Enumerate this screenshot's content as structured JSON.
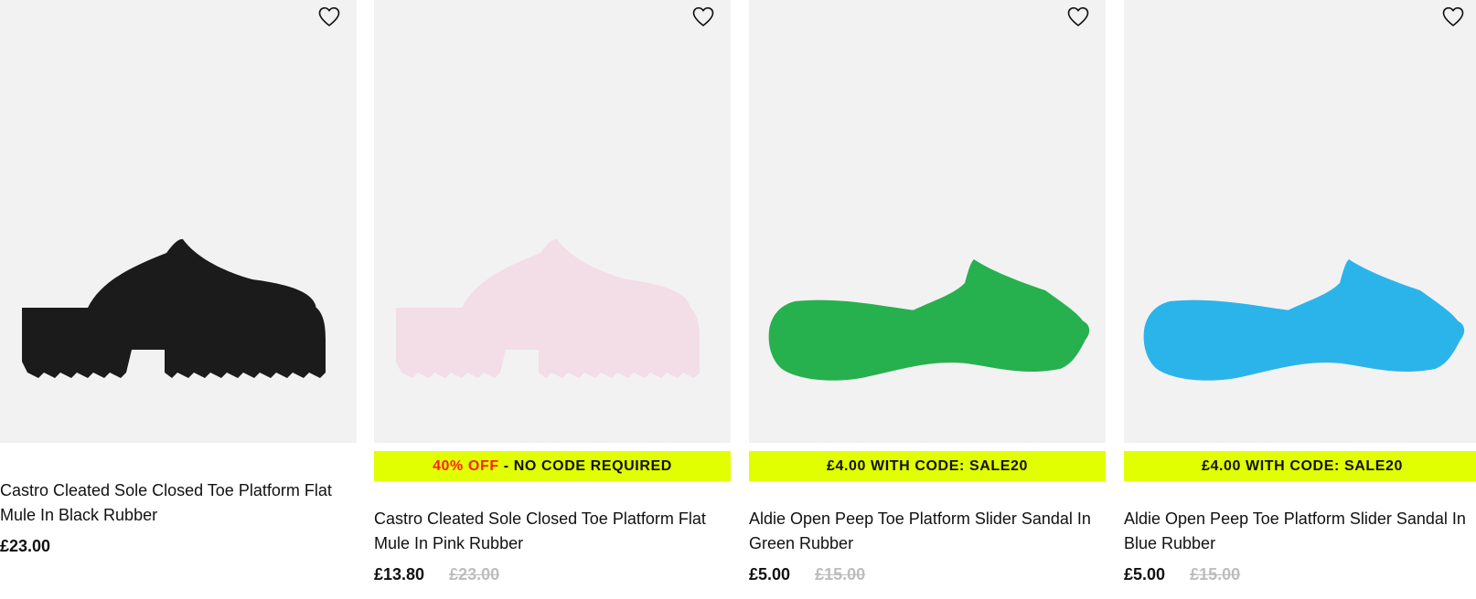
{
  "colors": {
    "image_bg": "#f2f2f2",
    "badge_bg": "#e1ff00",
    "badge_highlight": "#ff1f1f",
    "was_price": "#bdbdbd"
  },
  "products": [
    {
      "title": "Castro Cleated Sole Closed Toe Platform Flat Mule In Black Rubber",
      "price": "£23.00",
      "was_price": "",
      "badge_highlight": "",
      "badge_text": "",
      "shoe_color": "#1b1b1b",
      "icon": "heart-outline-icon"
    },
    {
      "title": "Castro Cleated Sole Closed Toe Platform Flat Mule In Pink Rubber",
      "price": "£13.80",
      "was_price": "£23.00",
      "badge_highlight": "40% OFF",
      "badge_text": " - NO CODE REQUIRED",
      "shoe_color": "#f3dde6",
      "icon": "heart-outline-icon"
    },
    {
      "title": "Aldie Open Peep Toe Platform Slider Sandal In Green Rubber",
      "price": "£5.00",
      "was_price": "£15.00",
      "badge_highlight": "",
      "badge_text": "£4.00 WITH CODE: SALE20",
      "shoe_color": "#27b04e",
      "icon": "heart-outline-icon"
    },
    {
      "title": "Aldie Open Peep Toe Platform Slider Sandal In Blue Rubber",
      "price": "£5.00",
      "was_price": "£15.00",
      "badge_highlight": "",
      "badge_text": "£4.00 WITH CODE: SALE20",
      "shoe_color": "#2bb4ea",
      "icon": "heart-outline-icon"
    }
  ]
}
